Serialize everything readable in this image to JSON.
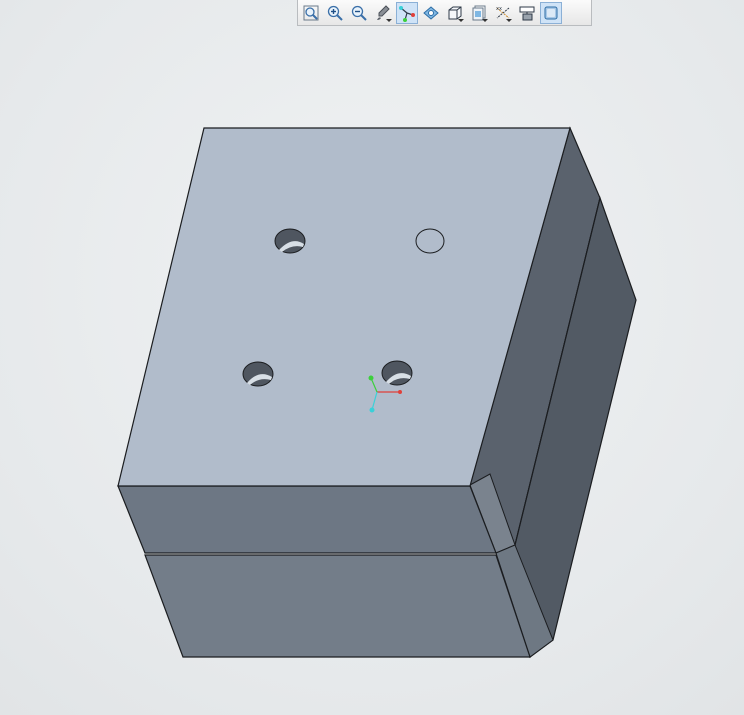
{
  "toolbar": {
    "buttons": [
      {
        "icon": "zoom-fit-icon"
      },
      {
        "icon": "zoom-in-icon"
      },
      {
        "icon": "zoom-out-icon"
      },
      {
        "icon": "repaint-icon"
      },
      {
        "icon": "spin-center-icon",
        "active": true
      },
      {
        "icon": "view-manager-icon"
      },
      {
        "icon": "saved-views-icon"
      },
      {
        "icon": "display-style-icon"
      },
      {
        "icon": "datum-display-icon"
      },
      {
        "icon": "annotation-display-icon"
      },
      {
        "icon": "shaded-view-icon",
        "active": true
      }
    ]
  },
  "colors": {
    "top_face": "#b1bccb",
    "front_face_upper": "#6d7784",
    "front_face_lower": "#737d89",
    "right_face": "#565e69",
    "edge": "#1b1d20",
    "axis_x": "#e0403a",
    "axis_y": "#3ccf3c",
    "axis_z": "#3ad0d8"
  }
}
